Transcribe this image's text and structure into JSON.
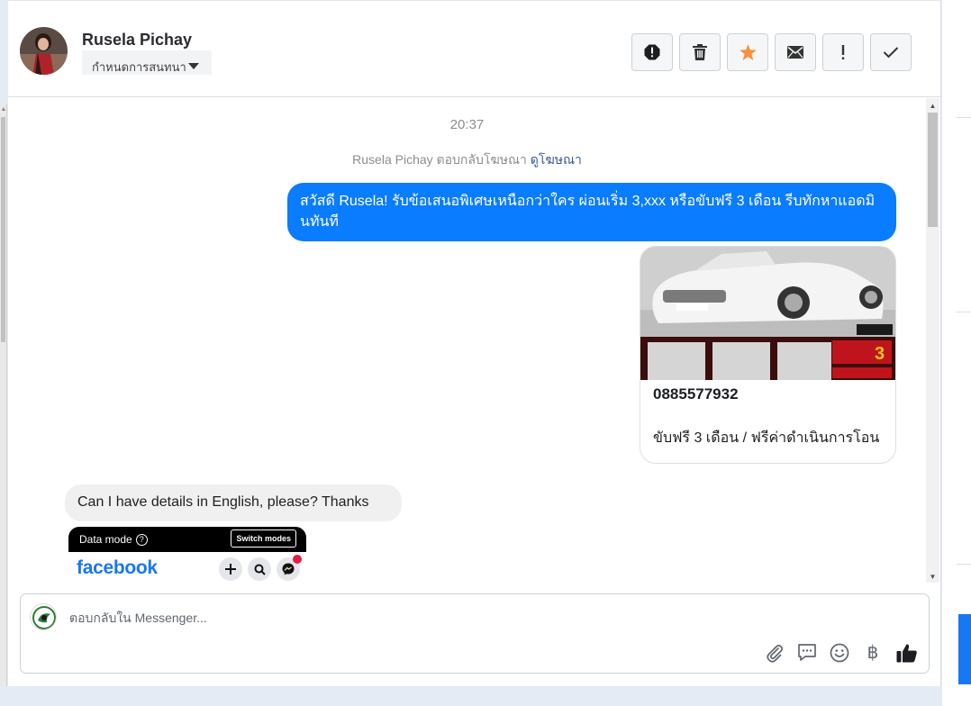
{
  "header": {
    "contact_name": "Rusela Pichay",
    "assign_label": "กำหนดการสนทนา",
    "actions": [
      {
        "name": "spam-button",
        "icon": "alert-octagon-icon"
      },
      {
        "name": "delete-button",
        "icon": "trash-icon"
      },
      {
        "name": "star-button",
        "icon": "star-icon"
      },
      {
        "name": "mark-unread-button",
        "icon": "envelope-icon"
      },
      {
        "name": "follow-up-button",
        "icon": "exclamation-icon"
      },
      {
        "name": "mark-done-button",
        "icon": "check-icon"
      }
    ]
  },
  "thread": {
    "timestamp": "20:37",
    "ad_reply_text": "Rusela Pichay ตอบกลับโฆษณา",
    "ad_link": "ดูโฆษณา",
    "outgoing_message": "สวัสดี Rusela! รับข้อเสนอพิเศษเหนือกว่าใคร ผ่อนเริ่ม 3,xxx หรือขับฟรี 3 เดือน รีบทักหาแอดมินทันที",
    "ad_card": {
      "phone": "0885577932",
      "description": "ขับฟรี 3 เดือน / ฟรีค่าดำเนินการโอน"
    },
    "incoming_message": "Can I have details in English, please? Thanks",
    "attachment": {
      "data_mode": "Data mode",
      "switch_modes": "Switch modes",
      "logo": "facebook"
    }
  },
  "composer": {
    "placeholder": "ตอบกลับใน Messenger...",
    "tools": [
      "paperclip-icon",
      "saved-replies-icon",
      "emoji-icon",
      "baht-icon",
      "thumbs-up-icon"
    ],
    "baht_symbol": "฿"
  },
  "colors": {
    "outgoing_bubble": "#0a7cff",
    "incoming_bubble": "#f0f0f0",
    "star": "#f7923b",
    "link": "#385898"
  }
}
